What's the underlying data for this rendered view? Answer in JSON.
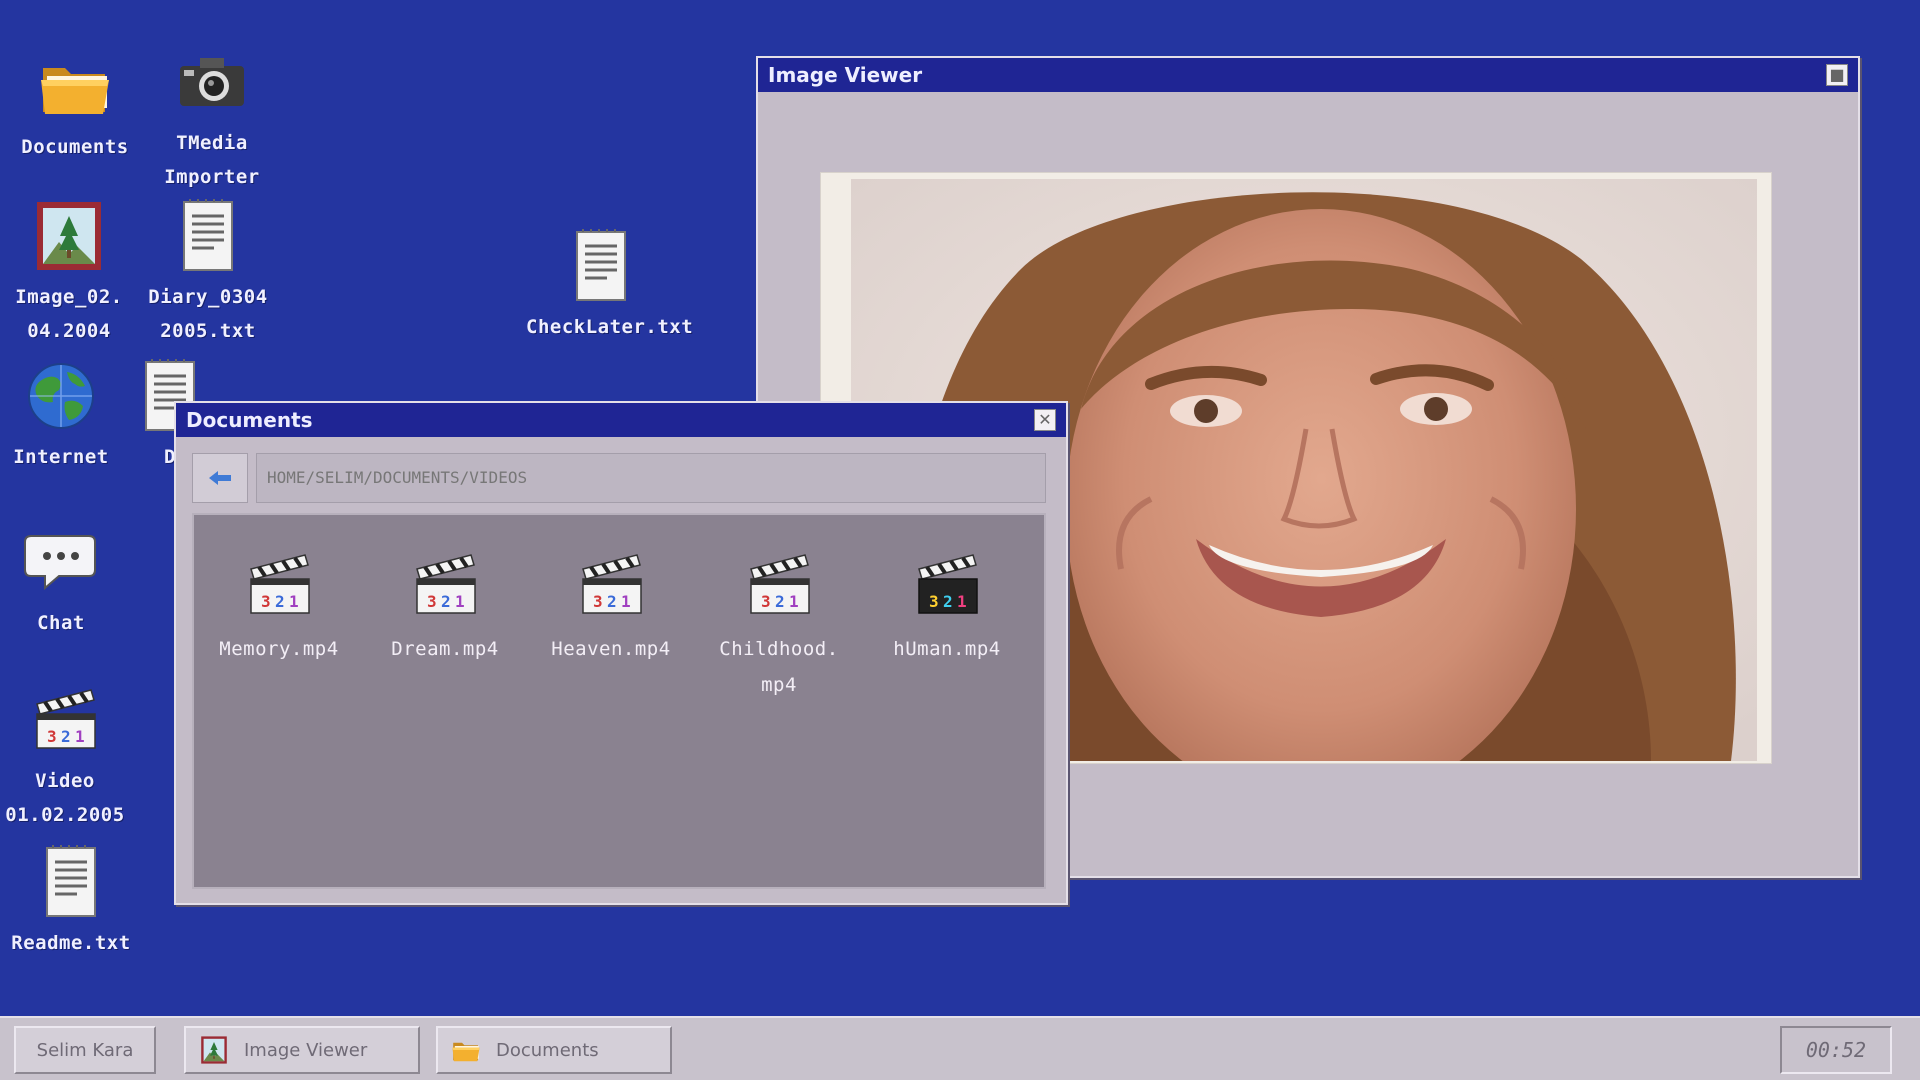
{
  "desktop": {
    "icons": [
      {
        "label": "Documents",
        "icon": "folder-icon"
      },
      {
        "label": "TMedia\nImporter",
        "icon": "camera-icon"
      },
      {
        "label": "Image_02.\n04.2004",
        "icon": "image-file-icon"
      },
      {
        "label": "Diary_0304\n2005.txt",
        "icon": "text-file-icon"
      },
      {
        "label": "CheckLater.txt",
        "icon": "text-file-icon"
      },
      {
        "label": "Internet",
        "icon": "globe-icon"
      },
      {
        "label": "D",
        "icon": "text-file-icon"
      },
      {
        "label": "Chat",
        "icon": "chat-bubble-icon"
      },
      {
        "label": "Video\n01.02.2005",
        "icon": "video-clapper-icon"
      },
      {
        "label": "Readme.txt",
        "icon": "text-file-icon"
      }
    ]
  },
  "image_viewer": {
    "title": "Image Viewer"
  },
  "documents_window": {
    "title": "Documents",
    "path": "HOME/SELIM/DOCUMENTS/VIDEOS",
    "files": [
      {
        "label": "Memory.mp4",
        "icon": "video-clapper-icon"
      },
      {
        "label": "Dream.mp4",
        "icon": "video-clapper-icon"
      },
      {
        "label": "Heaven.mp4",
        "icon": "video-clapper-icon"
      },
      {
        "label": "Childhood.\nmp4",
        "icon": "video-clapper-icon"
      },
      {
        "label": "hUman.mp4",
        "icon": "video-clapper-dark-icon"
      }
    ]
  },
  "taskbar": {
    "user": "Selim Kara",
    "tasks": [
      {
        "label": "Image Viewer",
        "icon": "image-file-icon"
      },
      {
        "label": "Documents",
        "icon": "folder-icon"
      }
    ],
    "clock": "00:52"
  },
  "colors": {
    "desktop": "#2435a0",
    "titlebar": "#1f2594",
    "window": "#c4bcc8",
    "file_pane": "#8a8290"
  }
}
